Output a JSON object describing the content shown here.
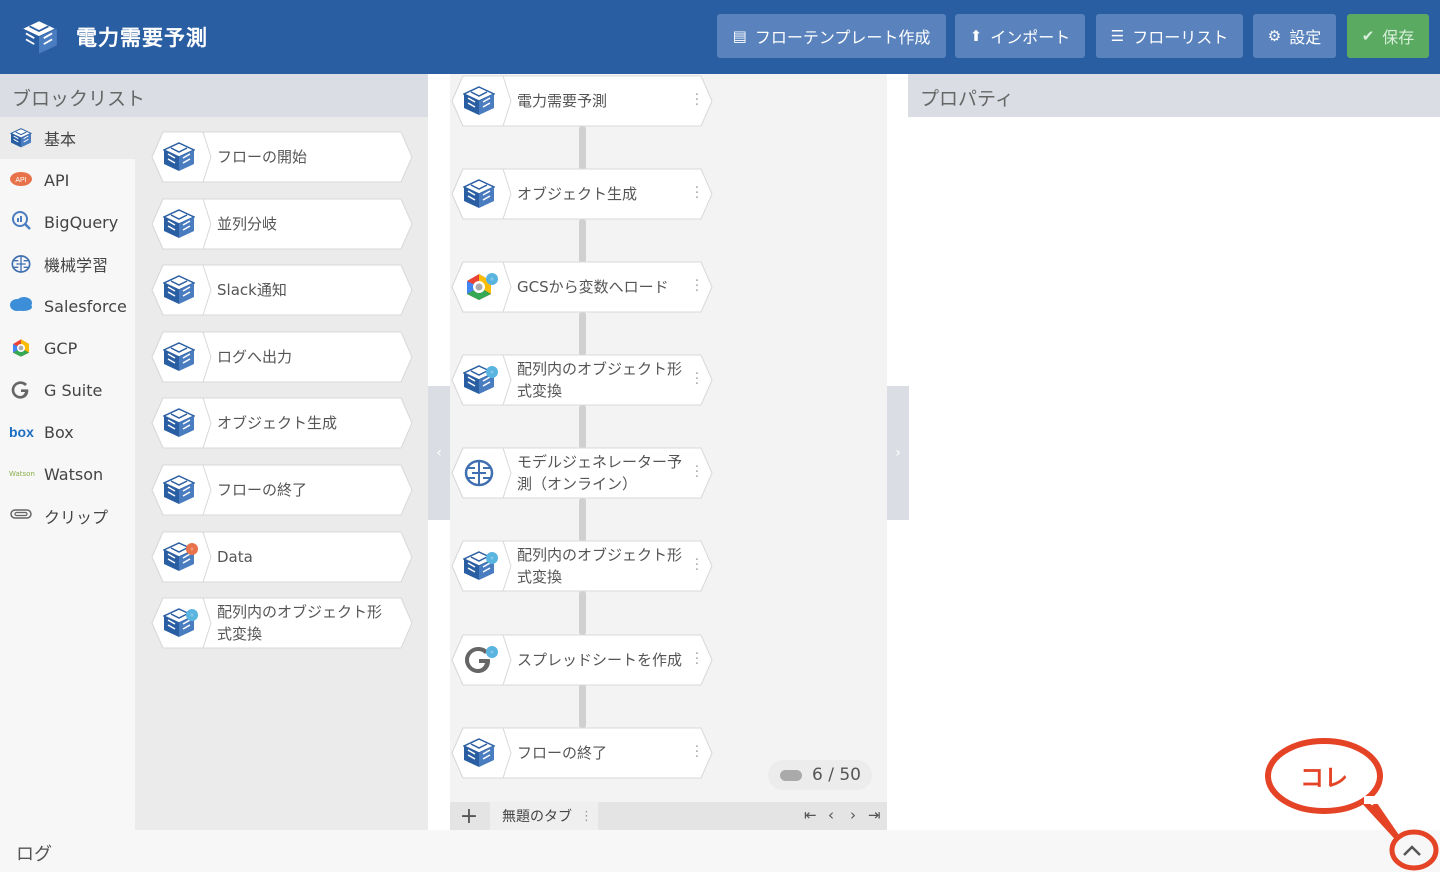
{
  "header": {
    "title": "電力需要予測",
    "buttons": {
      "template": "フローテンプレート作成",
      "import": "インポート",
      "flowlist": "フローリスト",
      "settings": "設定",
      "save": "保存"
    }
  },
  "blocklist": {
    "title": "ブロックリスト",
    "categories": [
      {
        "label": "基本",
        "icon": "cube-icon"
      },
      {
        "label": "API",
        "icon": "api-cloud-icon"
      },
      {
        "label": "BigQuery",
        "icon": "bigquery-icon"
      },
      {
        "label": "機械学習",
        "icon": "brain-icon"
      },
      {
        "label": "Salesforce",
        "icon": "salesforce-cloud-icon"
      },
      {
        "label": "GCP",
        "icon": "gcp-icon"
      },
      {
        "label": "G Suite",
        "icon": "google-g-icon"
      },
      {
        "label": "Box",
        "icon": "box-logo-icon"
      },
      {
        "label": "Watson",
        "icon": "watson-logo-icon"
      },
      {
        "label": "クリップ",
        "icon": "paperclip-icon"
      }
    ],
    "blocks": [
      {
        "label": "フローの開始"
      },
      {
        "label": "並列分岐"
      },
      {
        "label": "Slack通知"
      },
      {
        "label": "ログへ出力"
      },
      {
        "label": "オブジェクト生成"
      },
      {
        "label": "フローの終了"
      },
      {
        "label": "Data"
      },
      {
        "label": "配列内のオブジェクト形\n式変換"
      }
    ]
  },
  "flow": {
    "nodes": [
      {
        "label": "電力需要予測",
        "icon": "cube-icon"
      },
      {
        "label": "オブジェクト生成",
        "icon": "cube-icon"
      },
      {
        "label": "GCSから変数へロード",
        "icon": "gcp-icon"
      },
      {
        "label": "配列内のオブジェクト形\n式変換",
        "icon": "cube-icon"
      },
      {
        "label": "モデルジェネレーター予\n測（オンライン）",
        "icon": "brain-icon"
      },
      {
        "label": "配列内のオブジェクト形\n式変換",
        "icon": "cube-icon"
      },
      {
        "label": "スプレッドシートを作成",
        "icon": "google-g-icon"
      },
      {
        "label": "フローの終了",
        "icon": "cube-icon"
      }
    ],
    "counter": "6 / 50",
    "tab_label": "無題のタブ",
    "add_tab": "+"
  },
  "properties": {
    "title": "プロパティ"
  },
  "log": {
    "title": "ログ"
  },
  "annotation": {
    "text": "コレ"
  },
  "colors": {
    "header": "#2a5ea2",
    "button": "#5a83bd",
    "save": "#5aaa62",
    "accent_red": "#e54325"
  }
}
